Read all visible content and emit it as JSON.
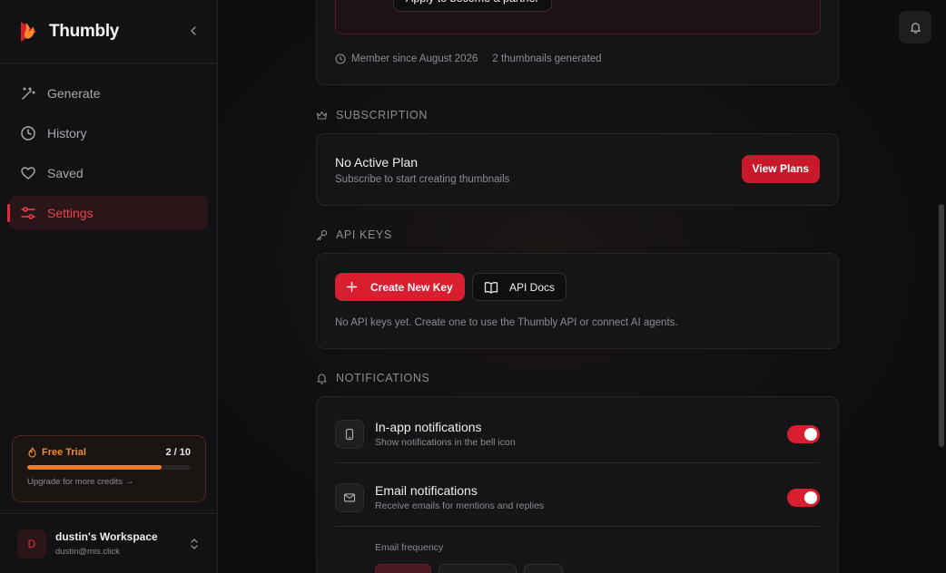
{
  "app": {
    "name": "Thumbly"
  },
  "nav": {
    "items": [
      {
        "label": "Generate",
        "icon": "wand-icon"
      },
      {
        "label": "History",
        "icon": "clock-icon"
      },
      {
        "label": "Saved",
        "icon": "heart-icon"
      },
      {
        "label": "Settings",
        "icon": "sliders-icon",
        "active": true
      }
    ]
  },
  "trial": {
    "label": "Free Trial",
    "count": "2 / 10",
    "used": 2,
    "total": 10,
    "upgrade": "Upgrade for more credits →"
  },
  "workspace": {
    "initial": "D",
    "name": "dustin's Workspace",
    "email": "dustin@mis.click"
  },
  "profile": {
    "partner_button": "Apply to become a partner",
    "member_since": "Member since August 2026",
    "thumbnails": "2 thumbnails generated"
  },
  "subscription": {
    "heading": "SUBSCRIPTION",
    "plan_title": "No Active Plan",
    "plan_sub": "Subscribe to start creating thumbnails",
    "button": "View Plans"
  },
  "api_keys": {
    "heading": "API KEYS",
    "create_button": "Create New Key",
    "docs_button": "API Docs",
    "empty": "No API keys yet. Create one to use the Thumbly API or connect AI agents."
  },
  "notifications": {
    "heading": "NOTIFICATIONS",
    "in_app": {
      "title": "In-app notifications",
      "sub": "Show notifications in the bell icon",
      "enabled": true
    },
    "email": {
      "title": "Email notifications",
      "sub": "Receive emails for mentions and replies",
      "enabled": true
    },
    "frequency_label": "Email frequency"
  },
  "colors": {
    "accent": "#d71f2f",
    "trial": "#f07a2c",
    "background": "#0e0d0f"
  }
}
